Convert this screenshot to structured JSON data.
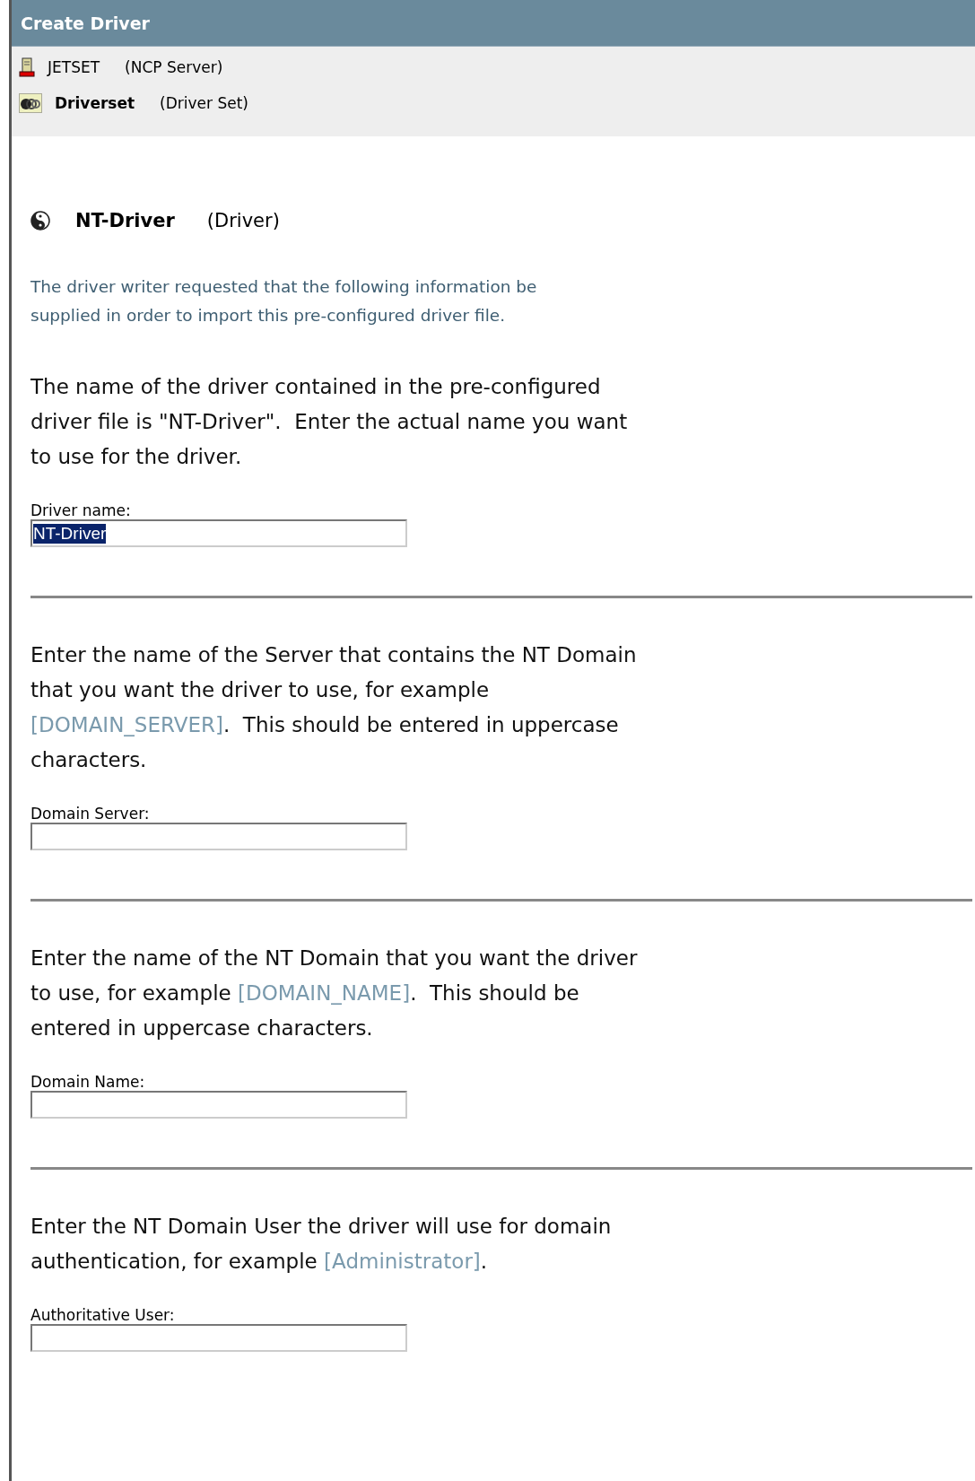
{
  "window": {
    "title": "Create Driver"
  },
  "context": [
    {
      "kind": "server",
      "name": "JETSET",
      "type": "(NCP Server)",
      "bold": false
    },
    {
      "kind": "driverset",
      "name": "Driverset",
      "type": "(Driver Set)",
      "bold": true
    }
  ],
  "driver": {
    "name": "NT-Driver",
    "type": "(Driver)"
  },
  "intro": "The driver writer requested that the following information be supplied in order to import this pre-configured driver file.",
  "sections": [
    {
      "prompt": "The name of the driver contained in the pre-configured driver file is \"NT-Driver\".  Enter the actual name you want to use for the driver.",
      "label": "Driver name:",
      "value": "NT-Driver",
      "value_selected": true
    },
    {
      "prompt": "Enter the name of the Server that contains the NT Domain that you want the driver to use, for example",
      "example": "[DOMAIN_SERVER]",
      "after": ".  This should be entered in uppercase characters.",
      "label": "Domain Server:"
    },
    {
      "prompt": "Enter the name of the NT Domain that you want the driver to use, for example",
      "example": "[DOMAIN_NAME]",
      "after": ".  This should be entered in uppercase characters.",
      "label": "Domain Name:"
    },
    {
      "prompt": "Enter the NT Domain User the driver will use for domain authentication, for example",
      "example": "[Administrator]",
      "after": ".",
      "label": "Authoritative User:"
    }
  ]
}
